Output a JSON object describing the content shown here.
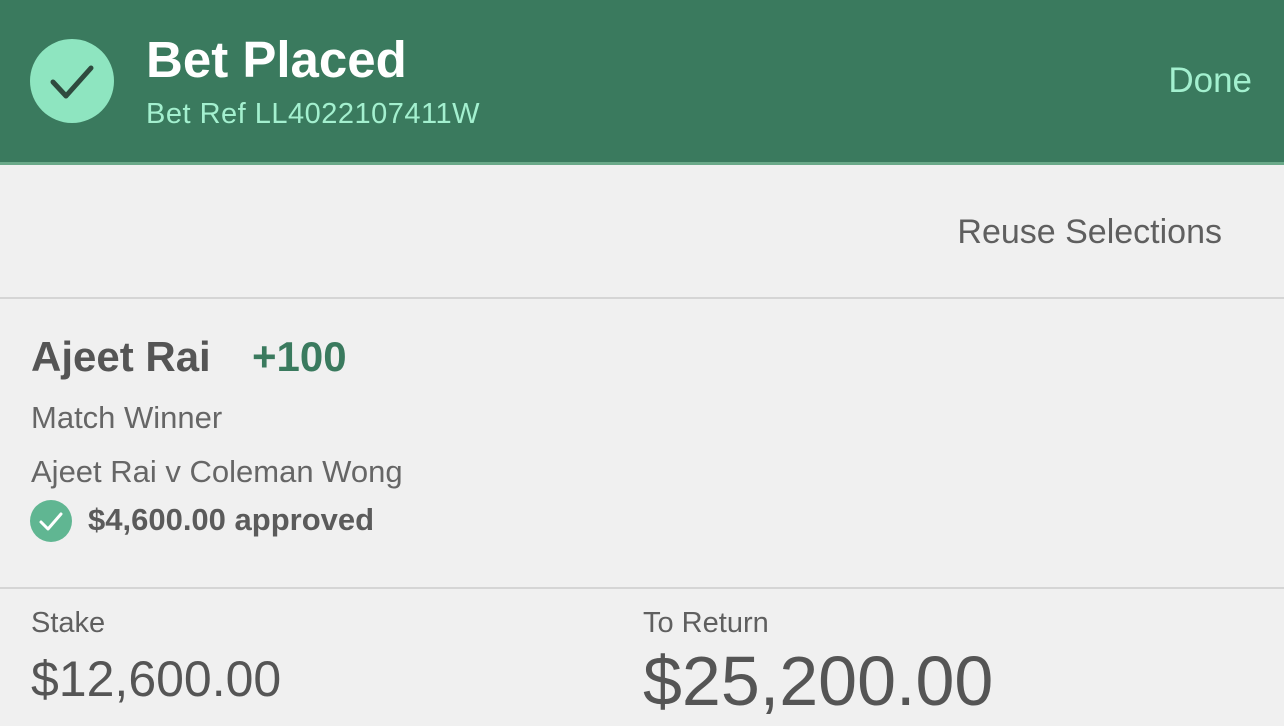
{
  "header": {
    "title": "Bet Placed",
    "bet_ref": "Bet Ref LL4022107411W",
    "done_label": "Done",
    "status_icon": "checkmark-icon",
    "background_color": "#3a7a5e",
    "accent_color": "#a3f0cf"
  },
  "actions": {
    "reuse_label": "Reuse Selections"
  },
  "selection": {
    "name": "Ajeet Rai",
    "odds": "+100",
    "market": "Match Winner",
    "event": "Ajeet Rai v Coleman Wong",
    "approved_icon": "check-circle-icon",
    "approved_text": "$4,600.00 approved",
    "odds_color": "#3a7a5e"
  },
  "totals": {
    "stake_label": "Stake",
    "stake_value": "$12,600.00",
    "return_label": "To Return",
    "return_value": "$25,200.00"
  }
}
